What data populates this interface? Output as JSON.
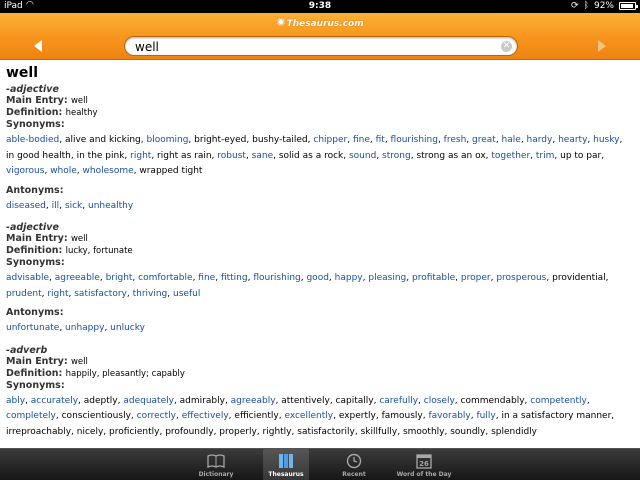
{
  "status": {
    "device": "iPad",
    "time": "9:38",
    "battery": "92%"
  },
  "nav": {
    "logo": "Thesaurus.com"
  },
  "search": {
    "value": "well"
  },
  "entry": {
    "headword": "well",
    "labels": {
      "main_entry": "Main Entry:",
      "definition": "Definition:",
      "synonyms": "Synonyms:",
      "antonyms": "Antonyms:"
    },
    "senses": [
      {
        "pos": "-adjective",
        "main_entry": "well",
        "definition": "healthy",
        "synonyms": [
          {
            "t": "able-bodied",
            "l": true
          },
          {
            "t": "alive and kicking",
            "l": false
          },
          {
            "t": "blooming",
            "l": true
          },
          {
            "t": "bright-eyed",
            "l": false
          },
          {
            "t": "bushy-tailed",
            "l": false
          },
          {
            "t": "chipper",
            "l": true
          },
          {
            "t": "fine",
            "l": true
          },
          {
            "t": "fit",
            "l": true
          },
          {
            "t": "flourishing",
            "l": true
          },
          {
            "t": "fresh",
            "l": true
          },
          {
            "t": "great",
            "l": true
          },
          {
            "t": "hale",
            "l": true
          },
          {
            "t": "hardy",
            "l": true
          },
          {
            "t": "hearty",
            "l": true
          },
          {
            "t": "husky",
            "l": true
          },
          {
            "t": "in good health",
            "l": false
          },
          {
            "t": "in the pink",
            "l": false
          },
          {
            "t": "right",
            "l": true
          },
          {
            "t": "right as rain",
            "l": false
          },
          {
            "t": "robust",
            "l": true
          },
          {
            "t": "sane",
            "l": true
          },
          {
            "t": "solid as a rock",
            "l": false
          },
          {
            "t": "sound",
            "l": true
          },
          {
            "t": "strong",
            "l": true
          },
          {
            "t": "strong as an ox",
            "l": false
          },
          {
            "t": "together",
            "l": true
          },
          {
            "t": "trim",
            "l": true
          },
          {
            "t": "up to par",
            "l": false
          },
          {
            "t": "vigorous",
            "l": true
          },
          {
            "t": "whole",
            "l": true
          },
          {
            "t": "wholesome",
            "l": true
          },
          {
            "t": "wrapped tight",
            "l": false
          }
        ],
        "antonyms": [
          {
            "t": "diseased",
            "l": true
          },
          {
            "t": "ill",
            "l": true
          },
          {
            "t": "sick",
            "l": true
          },
          {
            "t": "unhealthy",
            "l": true
          }
        ]
      },
      {
        "pos": "-adjective",
        "main_entry": "well",
        "definition": "lucky, fortunate",
        "synonyms": [
          {
            "t": "advisable",
            "l": true
          },
          {
            "t": "agreeable",
            "l": true
          },
          {
            "t": "bright",
            "l": true
          },
          {
            "t": "comfortable",
            "l": true
          },
          {
            "t": "fine",
            "l": true
          },
          {
            "t": "fitting",
            "l": true
          },
          {
            "t": "flourishing",
            "l": true
          },
          {
            "t": "good",
            "l": true
          },
          {
            "t": "happy",
            "l": true
          },
          {
            "t": "pleasing",
            "l": true
          },
          {
            "t": "profitable",
            "l": true
          },
          {
            "t": "proper",
            "l": true
          },
          {
            "t": "prosperous",
            "l": true
          },
          {
            "t": "providential",
            "l": false
          },
          {
            "t": "prudent",
            "l": true
          },
          {
            "t": "right",
            "l": true
          },
          {
            "t": "satisfactory",
            "l": true
          },
          {
            "t": "thriving",
            "l": true
          },
          {
            "t": "useful",
            "l": true
          }
        ],
        "antonyms": [
          {
            "t": "unfortunate",
            "l": true
          },
          {
            "t": "unhappy",
            "l": true
          },
          {
            "t": "unlucky",
            "l": true
          }
        ]
      },
      {
        "pos": "-adverb",
        "main_entry": "well",
        "definition": "happily, pleasantly; capably",
        "synonyms": [
          {
            "t": "ably",
            "l": true
          },
          {
            "t": "accurately",
            "l": true
          },
          {
            "t": "adeptly",
            "l": false
          },
          {
            "t": "adequately",
            "l": true
          },
          {
            "t": "admirably",
            "l": false
          },
          {
            "t": "agreeably",
            "l": true
          },
          {
            "t": "attentively",
            "l": false
          },
          {
            "t": "capitally",
            "l": false
          },
          {
            "t": "carefully",
            "l": true
          },
          {
            "t": "closely",
            "l": true
          },
          {
            "t": "commendably",
            "l": false
          },
          {
            "t": "competently",
            "l": true
          },
          {
            "t": "completely",
            "l": true
          },
          {
            "t": "conscientiously",
            "l": false
          },
          {
            "t": "correctly",
            "l": true
          },
          {
            "t": "effectively",
            "l": true
          },
          {
            "t": "efficiently",
            "l": false
          },
          {
            "t": "excellently",
            "l": true
          },
          {
            "t": "expertly",
            "l": false
          },
          {
            "t": "famously",
            "l": false
          },
          {
            "t": "favorably",
            "l": true
          },
          {
            "t": "fully",
            "l": true
          },
          {
            "t": "in a satisfactory manner",
            "l": false
          },
          {
            "t": "irreproachably",
            "l": false
          },
          {
            "t": "nicely",
            "l": false
          },
          {
            "t": "proficiently",
            "l": false
          },
          {
            "t": "profoundly",
            "l": false
          },
          {
            "t": "properly",
            "l": false
          },
          {
            "t": "rightly",
            "l": false
          },
          {
            "t": "satisfactorily",
            "l": false
          },
          {
            "t": "skillfully",
            "l": false
          },
          {
            "t": "smoothly",
            "l": false
          },
          {
            "t": "soundly",
            "l": false
          },
          {
            "t": "splendidly",
            "l": false
          }
        ]
      }
    ]
  },
  "tabs": [
    {
      "label": "Dictionary",
      "icon": "book-icon",
      "active": false
    },
    {
      "label": "Thesaurus",
      "icon": "books-icon",
      "active": true
    },
    {
      "label": "Recent",
      "icon": "clock-icon",
      "active": false
    },
    {
      "label": "Word of the Day",
      "icon": "calendar-icon",
      "active": false,
      "calendar_day": "26"
    }
  ],
  "colors": {
    "nav_orange": "#f7941d",
    "link_blue": "#1a4fa0",
    "tabbar_dark": "#161616"
  }
}
